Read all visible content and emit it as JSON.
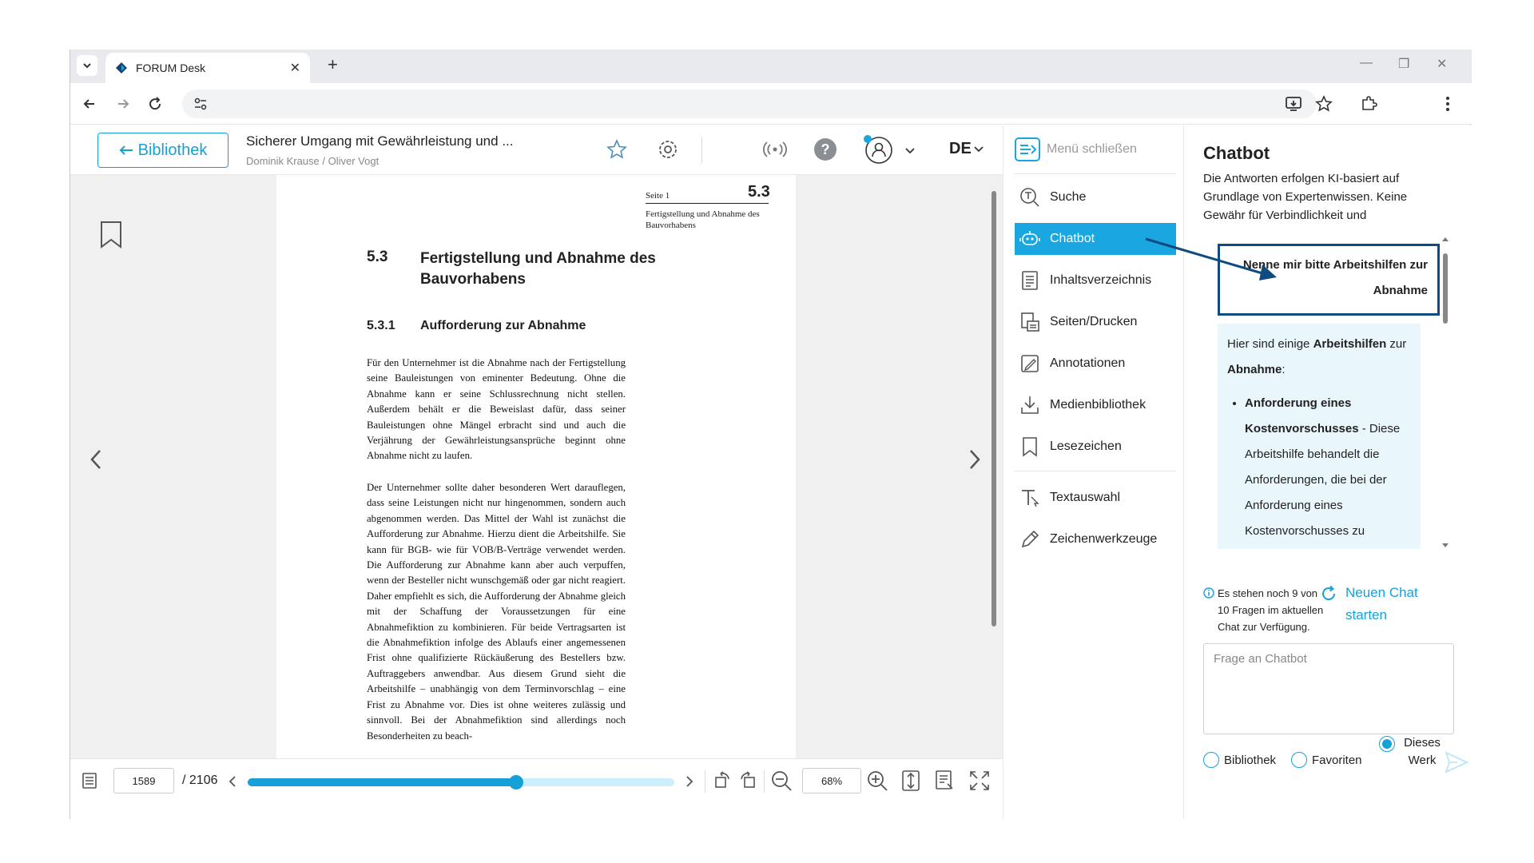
{
  "browser": {
    "tab_title": "FORUM Desk",
    "new_tab": "+",
    "close_tab": "✕",
    "minimize": "—",
    "restore": "❐",
    "close_window": "✕"
  },
  "header": {
    "library_button": "Bibliothek",
    "doc_title": "Sicherer Umgang mit Gewährleistung und ...",
    "doc_authors": "Dominik Krause / Oliver Vogt",
    "language": "DE"
  },
  "page": {
    "head_left": "Seite 1",
    "head_right": "5.3",
    "head_sub": "Fertigstellung und Abnahme des Bauvorhabens",
    "section_num": "5.3",
    "section_title": "Fertigstellung und Abnahme des Bauvorhabens",
    "subsection_num": "5.3.1",
    "subsection_title": "Aufforderung zur Abnahme",
    "para1": "Für den Unternehmer ist die Abnahme nach der Fertigstellung seine Bauleistungen von eminenter Bedeutung. Ohne die Abnahme kann er seine Schlussrechnung nicht stellen. Außerdem behält er die Beweislast dafür, dass seiner Bauleistungen ohne Mängel erbracht sind und auch die Verjährung der Gewährleistungsansprüche beginnt ohne Abnahme nicht zu laufen.",
    "para2": "Der Unternehmer sollte daher besonderen Wert darauflegen, dass seine Leistungen nicht nur hingenommen, sondern auch abgenommen werden. Das Mittel der Wahl ist zunächst die Aufforderung zur Abnahme. Hierzu dient die Arbeitshilfe. Sie kann für BGB- wie für VOB/B-Verträge verwendet werden. Die Aufforderung zur Abnahme kann aber auch verpuffen, wenn der Besteller nicht wunschgemäß oder gar nicht reagiert. Daher empfiehlt es sich, die Aufforderung der Abnahme gleich mit der Schaffung der Voraussetzungen für eine Abnahmefiktion zu kombinieren. Für beide Vertragsarten ist die Abnahmefiktion infolge des Ablaufs einer angemessenen Frist ohne qualifizierte Rückäußerung des Bestellers bzw. Auftraggebers anwendbar. Aus diesem Grund sieht die Arbeitshilfe – unabhängig von dem Terminvorschlag – eine Frist zu Abnahme vor. Dies ist ohne weiteres zulässig und sinnvoll. Bei der Abnahmefiktion sind allerdings noch Besonderheiten zu beach-"
  },
  "toolbar": {
    "page_current": "1589",
    "page_total": "/ 2106",
    "progress": 0.63,
    "zoom": "68%"
  },
  "menu": {
    "close_label": "Menü schließen",
    "items": [
      {
        "label": "Suche",
        "icon": "search-icon"
      },
      {
        "label": "Chatbot",
        "icon": "chatbot-icon"
      },
      {
        "label": "Inhaltsverzeichnis",
        "icon": "toc-icon"
      },
      {
        "label": "Seiten/Drucken",
        "icon": "print-icon"
      },
      {
        "label": "Annotationen",
        "icon": "annotation-icon"
      },
      {
        "label": "Medienbibliothek",
        "icon": "download-icon"
      },
      {
        "label": "Lesezeichen",
        "icon": "bookmark-icon"
      },
      {
        "label": "Textauswahl",
        "icon": "text-select-icon"
      },
      {
        "label": "Zeichenwerkzeuge",
        "icon": "pen-icon"
      }
    ]
  },
  "chat": {
    "title": "Chatbot",
    "disclaimer": "Die Antworten erfolgen KI-basiert auf Grundlage von Expertenwissen. Keine Gewähr für Verbindlichkeit und",
    "user_message": "Nenne mir bitte Arbeitshilfen zur Abnahme",
    "bot_intro_1": "Hier sind einige ",
    "bot_intro_bold": "Arbeitshilfen",
    "bot_intro_2": " zur ",
    "bot_intro_bold2": "Abnahme",
    "bot_intro_3": ":",
    "bot_item_title": "Anforderung eines Kostenvorschusses",
    "bot_item_text": " - Diese Arbeitshilfe behandelt die Anforderungen, die bei der Anforderung eines Kostenvorschusses zu beachten sind.",
    "info": "Es stehen noch 9 von 10 Fragen im aktuellen Chat zur Verfügung.",
    "new_chat": "Neuen Chat starten",
    "input_placeholder": "Frage an Chatbot",
    "radio_library": "Bibliothek",
    "radio_favorites": "Favoriten",
    "radio_this_work": "Dieses Werk"
  },
  "colors": {
    "accent": "#19a6e1",
    "highlight_border": "#0f4b80"
  }
}
